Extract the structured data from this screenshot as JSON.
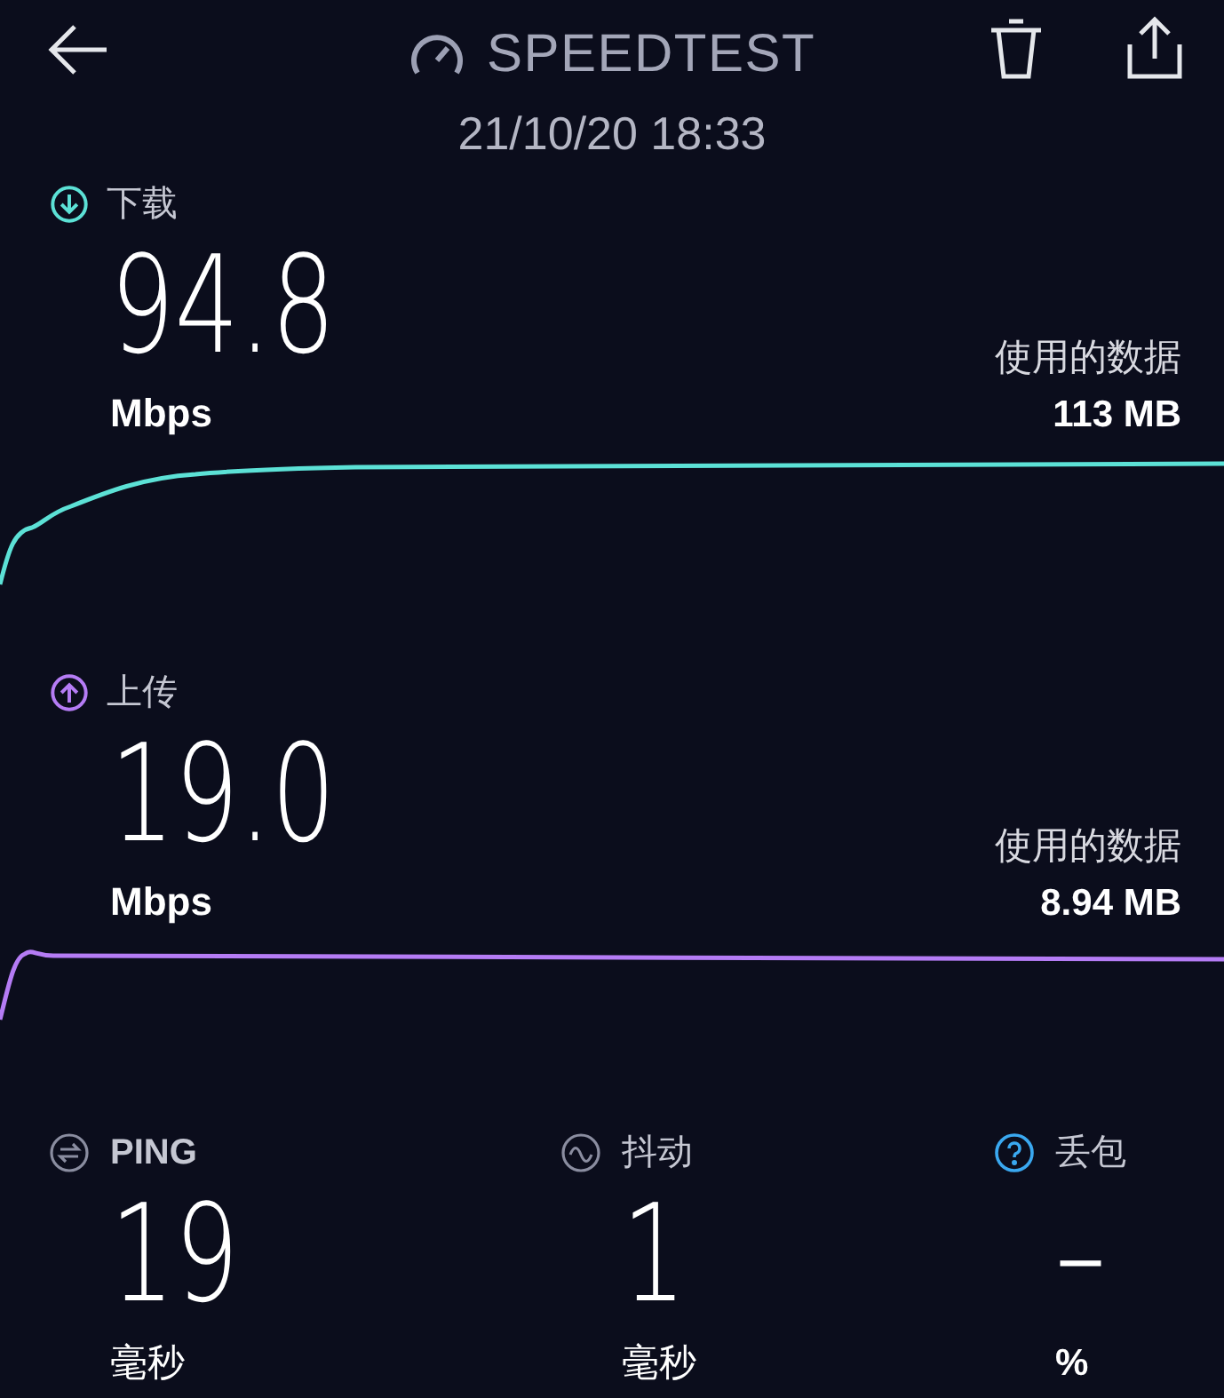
{
  "header": {
    "title": "SPEEDTEST",
    "timestamp": "21/10/20 18:33"
  },
  "speeds": [
    {
      "kind": "download",
      "label": "下载",
      "value": "94.8",
      "unit": "Mbps",
      "data_label": "使用的数据",
      "data_value": "113 MB",
      "color": "#5ce1d6"
    },
    {
      "kind": "upload",
      "label": "上传",
      "value": "19.0",
      "unit": "Mbps",
      "data_label": "使用的数据",
      "data_value": "8.94 MB",
      "color": "#b57cf5"
    }
  ],
  "stats": [
    {
      "kind": "ping",
      "label": "PING",
      "value": "19",
      "unit": "毫秒"
    },
    {
      "kind": "jitter",
      "label": "抖动",
      "value": "1",
      "unit": "毫秒"
    },
    {
      "kind": "loss",
      "label": "丢包",
      "value": "–",
      "unit": "%"
    }
  ]
}
